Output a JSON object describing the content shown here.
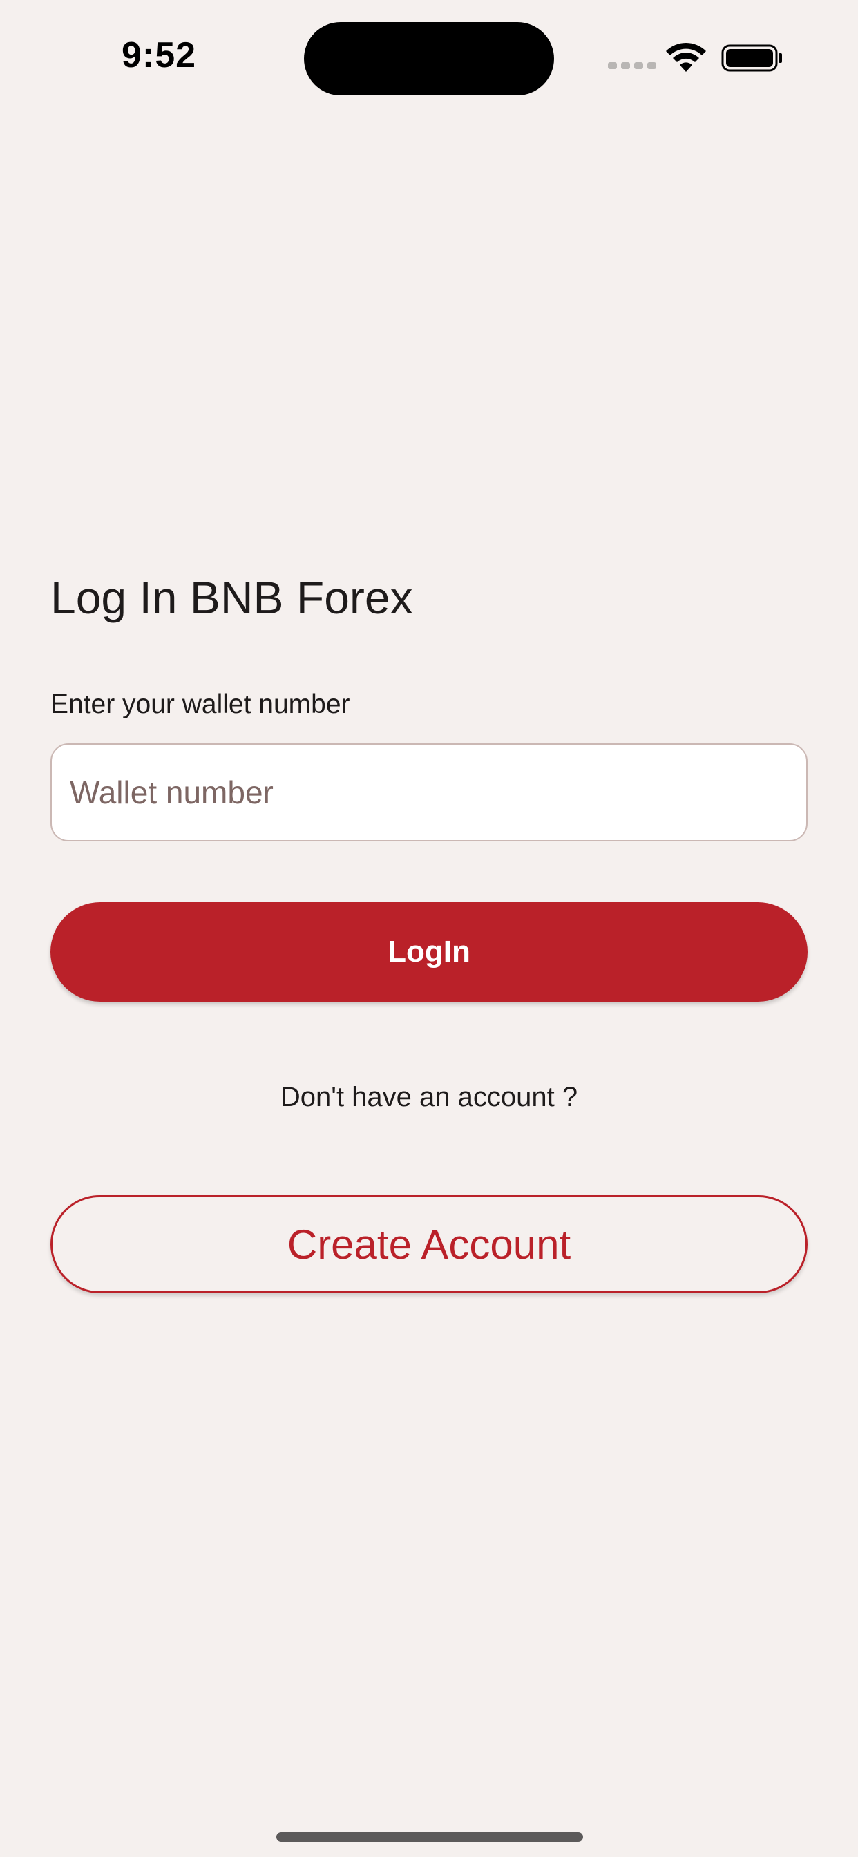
{
  "status_bar": {
    "time": "9:52",
    "icons": [
      "signal-dots-icon",
      "wifi-icon",
      "battery-icon"
    ]
  },
  "login": {
    "title": "Log In BNB Forex",
    "field_label": "Enter your wallet number",
    "wallet_placeholder": "Wallet number",
    "wallet_value": "",
    "login_label": "LogIn",
    "prompt": "Don't have an account ?",
    "create_label": "Create Account"
  },
  "colors": {
    "background": "#f5f0ee",
    "accent": "#ba2129",
    "input_border": "#cbb8b4",
    "placeholder": "#7d6663"
  }
}
